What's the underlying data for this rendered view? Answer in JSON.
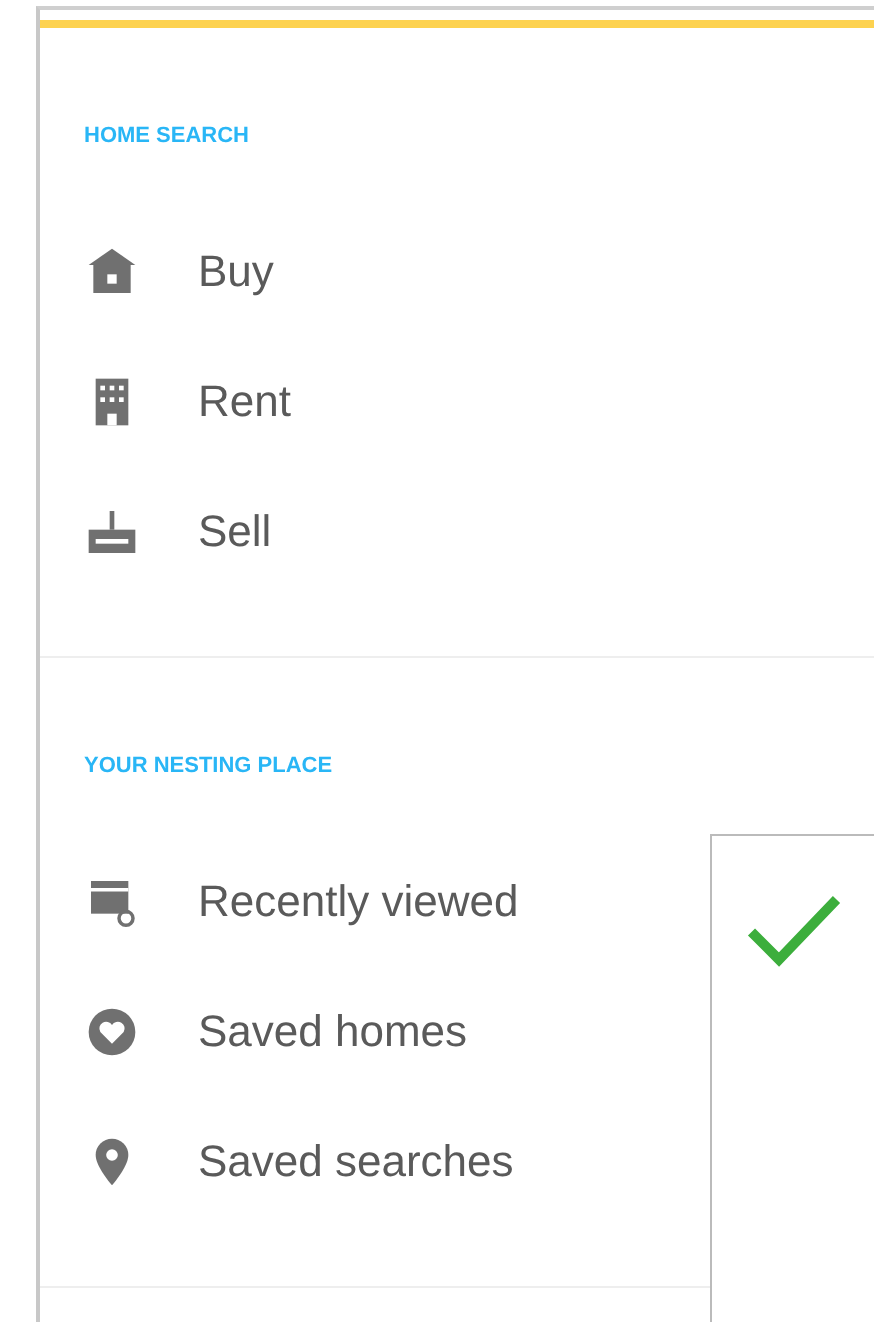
{
  "sections": [
    {
      "heading": "HOME SEARCH",
      "items": [
        {
          "label": "Buy"
        },
        {
          "label": "Rent"
        },
        {
          "label": "Sell"
        }
      ]
    },
    {
      "heading": "YOUR NESTING PLACE",
      "items": [
        {
          "label": "Recently viewed"
        },
        {
          "label": "Saved homes"
        },
        {
          "label": "Saved searches"
        }
      ]
    }
  ]
}
